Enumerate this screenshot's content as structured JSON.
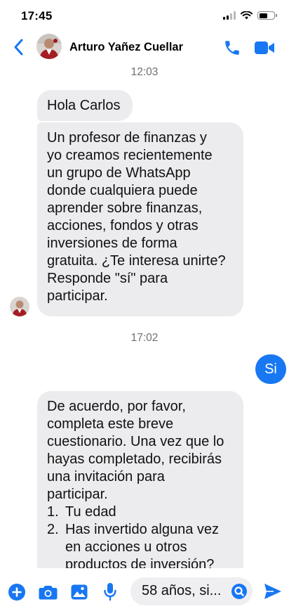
{
  "status": {
    "time": "17:45"
  },
  "header": {
    "contact_name": "Arturo Yañez Cuellar",
    "icons": [
      "chevron-left-icon",
      "avatar",
      "phone-icon",
      "video-camera-icon"
    ]
  },
  "conversation": {
    "time_separators": [
      "12:03",
      "17:02"
    ],
    "greeting": "Hola Carlos",
    "invite_lines": [
      "Un profesor de finanzas y",
      "yo creamos recientemente",
      "un grupo de WhatsApp",
      "donde cualquiera puede",
      "aprender sobre finanzas,",
      "acciones, fondos y otras",
      "inversiones de forma",
      "gratuita. ¿Te interesa unirte?",
      "Responde \"sí\" para",
      "participar."
    ],
    "reply": "Si",
    "survey_lines": [
      "De acuerdo, por favor,",
      "completa este breve",
      "cuestionario. Una vez que lo",
      "hayas completado, recibirás",
      "una invitación para",
      "participar."
    ],
    "survey_items": [
      {
        "num": "1.",
        "lines": [
          "Tu edad"
        ]
      },
      {
        "num": "2.",
        "lines": [
          "Has invertido alguna vez",
          "en acciones u otros",
          "productos de inversión?"
        ]
      }
    ]
  },
  "composer": {
    "input_text": "58 años, si...",
    "icons": [
      "plus-icon",
      "camera-icon",
      "gallery-icon",
      "microphone-icon",
      "emoji-icon",
      "send-icon"
    ]
  },
  "colors": {
    "accent": "#1877f2",
    "incoming_bubble": "#ececef",
    "separator_text": "#6e6e73"
  }
}
